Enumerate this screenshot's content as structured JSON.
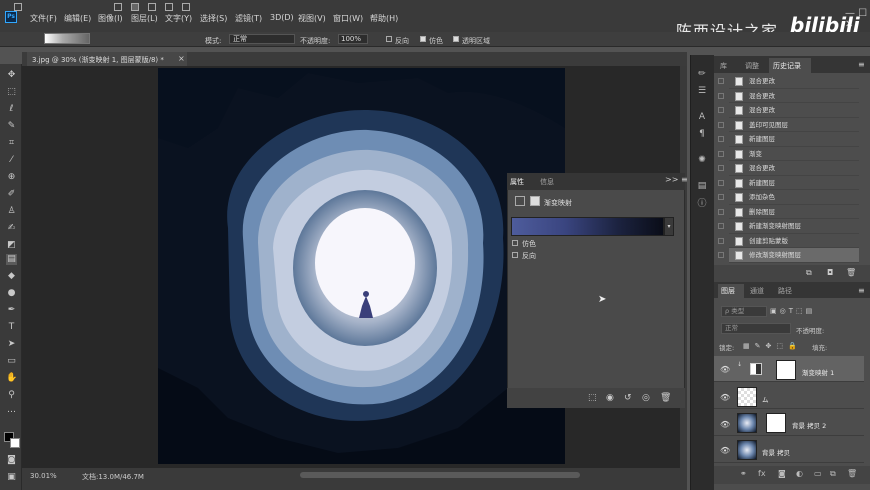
{
  "app": {
    "logo_text": "Ps"
  },
  "menu": [
    "文件(F)",
    "编辑(E)",
    "图像(I)",
    "图层(L)",
    "文字(Y)",
    "选择(S)",
    "滤镜(T)",
    "3D(D)",
    "视图(V)",
    "窗口(W)",
    "帮助(H)"
  ],
  "watermark": {
    "text": "陈西设计之家",
    "logo": "bilibili"
  },
  "window_controls": "— ☐ ✕",
  "options_bar": {
    "mode_label": "模式:",
    "mode_value": "正常",
    "opacity_label": "不透明度:",
    "opacity_value": "100%",
    "reverse_label": "反向",
    "dither_label": "仿色",
    "transparency_label": "透明区域"
  },
  "document_tab": {
    "title": "3.jpg @ 30% (渐变映射 1, 图层蒙版/8) *",
    "close": "×"
  },
  "status": {
    "zoom": "30.01%",
    "doc": "文档:13.0M/46.7M"
  },
  "properties": {
    "tab_active": "属性",
    "tab_other": "信息",
    "menu_icon": ">> ≡",
    "title": "渐变映射",
    "dither_label": "仿色",
    "reverse_label": "反向",
    "dropdown_arrow": "▾",
    "gradient_colors": [
      "#4e5c9c",
      "#3a4580",
      "#1c2340",
      "#0a0d18"
    ]
  },
  "history": {
    "tabs": [
      "库",
      "调整",
      "历史记录"
    ],
    "items": [
      "混合更改",
      "混合更改",
      "混合更改",
      "盖印可见图层",
      "新建图层",
      "渐变",
      "混合更改",
      "新建图层",
      "添加杂色",
      "删除图层",
      "新建渐变映射图层",
      "创建剪贴蒙版",
      "修改渐变映射图层"
    ],
    "selected_index": 12
  },
  "layers": {
    "tabs": [
      "图层",
      "通道",
      "路径"
    ],
    "filter_placeholder": "ρ 类型",
    "blend_mode": "正常",
    "opacity_label": "不透明度:",
    "lock_label": "锁定:",
    "fill_label": "填充:",
    "rows": [
      {
        "name": "渐变映射 1",
        "selected": true
      },
      {
        "name": "ム",
        "selected": false
      },
      {
        "name": "背景 拷贝 2",
        "selected": false
      },
      {
        "name": "背景 拷贝",
        "selected": false
      }
    ]
  }
}
